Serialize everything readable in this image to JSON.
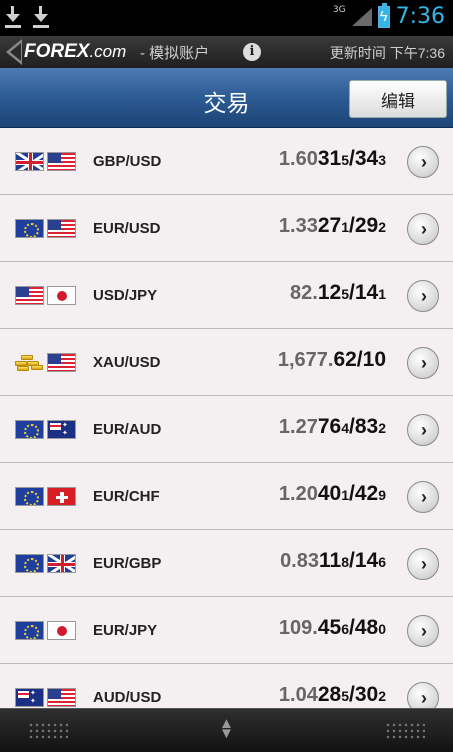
{
  "status_bar": {
    "network": "3G",
    "time": "7:36",
    "icons": [
      "download-icon",
      "download-icon",
      "signal-icon",
      "battery-charging-icon"
    ]
  },
  "brand": {
    "logo_main": "FOREX",
    "logo_suffix": ".com",
    "account": "- 模拟账户",
    "updated": "更新时间 下午7:36"
  },
  "header": {
    "title": "交易",
    "edit_label": "编辑"
  },
  "rows": [
    {
      "pair": "GBP/USD",
      "flags": [
        "uk",
        "us"
      ],
      "q_prefix": "1.60",
      "q_big": "31",
      "q_pip": "5",
      "q_sep": "/",
      "q_big2": "34",
      "q_pip2": "3"
    },
    {
      "pair": "EUR/USD",
      "flags": [
        "eu",
        "us"
      ],
      "q_prefix": "1.33",
      "q_big": "27",
      "q_pip": "1",
      "q_sep": "/",
      "q_big2": "29",
      "q_pip2": "2"
    },
    {
      "pair": "USD/JPY",
      "flags": [
        "us",
        "jp"
      ],
      "q_prefix": "82.",
      "q_big": "12",
      "q_pip": "5",
      "q_sep": "/",
      "q_big2": "14",
      "q_pip2": "1"
    },
    {
      "pair": "XAU/USD",
      "flags": [
        "gold",
        "us"
      ],
      "q_prefix": "1,677.",
      "q_big": "62",
      "q_pip": "",
      "q_sep": "/",
      "q_big2": "10",
      "q_pip2": ""
    },
    {
      "pair": "EUR/AUD",
      "flags": [
        "eu",
        "au"
      ],
      "q_prefix": "1.27",
      "q_big": "76",
      "q_pip": "4",
      "q_sep": "/",
      "q_big2": "83",
      "q_pip2": "2"
    },
    {
      "pair": "EUR/CHF",
      "flags": [
        "eu",
        "ch"
      ],
      "q_prefix": "1.20",
      "q_big": "40",
      "q_pip": "1",
      "q_sep": "/",
      "q_big2": "42",
      "q_pip2": "9"
    },
    {
      "pair": "EUR/GBP",
      "flags": [
        "eu",
        "uk"
      ],
      "q_prefix": "0.83",
      "q_big": "11",
      "q_pip": "8",
      "q_sep": "/",
      "q_big2": "14",
      "q_pip2": "6"
    },
    {
      "pair": "EUR/JPY",
      "flags": [
        "eu",
        "jp"
      ],
      "q_prefix": "109.",
      "q_big": "45",
      "q_pip": "6",
      "q_sep": "/",
      "q_big2": "48",
      "q_pip2": "0"
    },
    {
      "pair": "AUD/USD",
      "flags": [
        "au",
        "us"
      ],
      "q_prefix": "1.04",
      "q_big": "28",
      "q_pip": "5",
      "q_sep": "/",
      "q_big2": "30",
      "q_pip2": "2"
    }
  ],
  "colors": {
    "accent_time": "#33b5e5",
    "title_bar": "#2d5b94",
    "list_bg": "#f4eff1"
  }
}
